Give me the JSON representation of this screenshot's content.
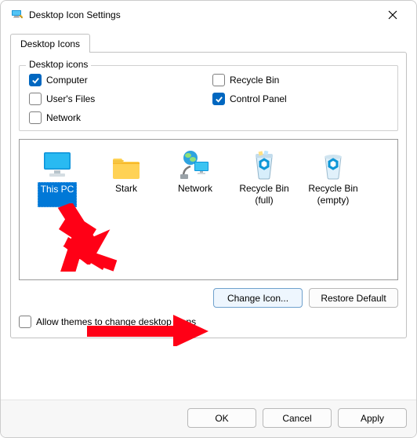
{
  "window": {
    "title": "Desktop Icon Settings"
  },
  "tabs": {
    "main": "Desktop Icons"
  },
  "group": {
    "legend": "Desktop icons",
    "computer": "Computer",
    "recycle": "Recycle Bin",
    "userfiles": "User's Files",
    "cpanel": "Control Panel",
    "network": "Network"
  },
  "icons": {
    "thispc": "This PC",
    "stark": "Stark",
    "network": "Network",
    "rbfull": "Recycle Bin (full)",
    "rbempty": "Recycle Bin (empty)"
  },
  "buttons": {
    "change": "Change Icon...",
    "restore": "Restore Default"
  },
  "allowthemes": "Allow themes to change desktop icons",
  "footer": {
    "ok": "OK",
    "cancel": "Cancel",
    "apply": "Apply"
  }
}
